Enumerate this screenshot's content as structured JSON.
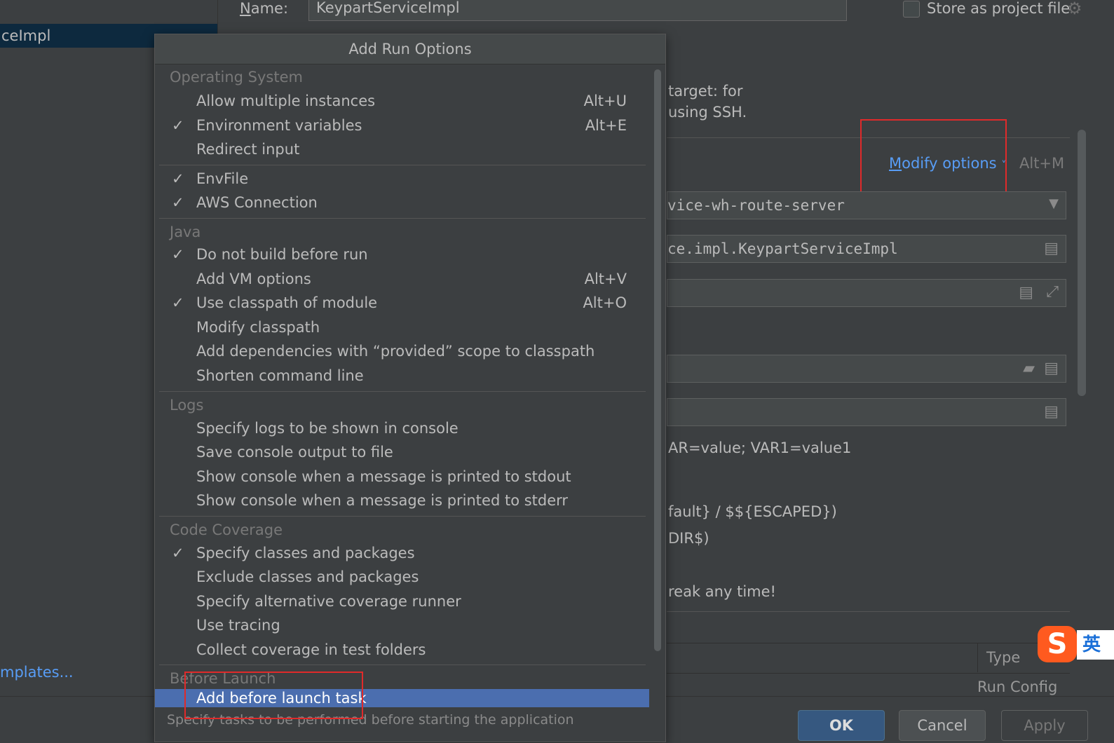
{
  "header": {
    "name_label": "Name:",
    "name_value": "KeypartServiceImpl",
    "store_label": "Store as project file"
  },
  "left_panel": {
    "selected_item": "ceImpl",
    "templates_link": "mplates..."
  },
  "right_panel": {
    "target_line1": "target: for",
    "target_line2": "using SSH.",
    "modify_options": "Modify options",
    "modify_shortcut": "Alt+M",
    "module_value": "vice-wh-route-server",
    "main_class_value": "ce.impl.KeypartServiceImpl",
    "env_hint": "AR=value; VAR1=value1",
    "escape_hint": "fault} / $${ESCAPED})",
    "dir_hint": "DIR$)",
    "break_hint": "reak any time!",
    "type_header": "Type",
    "run_config": "Run Config"
  },
  "buttons": {
    "ok": "OK",
    "cancel": "Cancel",
    "apply": "Apply"
  },
  "ime": {
    "char": "英"
  },
  "popup": {
    "title": "Add Run Options",
    "footer": "Specify tasks to be performed before starting the application",
    "sections": {
      "os": "Operating System",
      "java": "Java",
      "logs": "Logs",
      "coverage": "Code Coverage",
      "before_launch": "Before Launch"
    },
    "items": [
      {
        "label": "Allow multiple instances",
        "shortcut": "Alt+U",
        "checked": false
      },
      {
        "label": "Environment variables",
        "shortcut": "Alt+E",
        "checked": true
      },
      {
        "label": "Redirect input",
        "shortcut": "",
        "checked": false
      },
      {
        "label": "EnvFile",
        "shortcut": "",
        "checked": true
      },
      {
        "label": "AWS Connection",
        "shortcut": "",
        "checked": true
      },
      {
        "label": "Do not build before run",
        "shortcut": "",
        "checked": true
      },
      {
        "label": "Add VM options",
        "shortcut": "Alt+V",
        "checked": false
      },
      {
        "label": "Use classpath of module",
        "shortcut": "Alt+O",
        "checked": true
      },
      {
        "label": "Modify classpath",
        "shortcut": "",
        "checked": false
      },
      {
        "label": "Add dependencies with “provided” scope to classpath",
        "shortcut": "",
        "checked": false
      },
      {
        "label": "Shorten command line",
        "shortcut": "",
        "checked": false
      },
      {
        "label": "Specify logs to be shown in console",
        "shortcut": "",
        "checked": false
      },
      {
        "label": "Save console output to file",
        "shortcut": "",
        "checked": false
      },
      {
        "label": "Show console when a message is printed to stdout",
        "shortcut": "",
        "checked": false
      },
      {
        "label": "Show console when a message is printed to stderr",
        "shortcut": "",
        "checked": false
      },
      {
        "label": "Specify classes and packages",
        "shortcut": "",
        "checked": true
      },
      {
        "label": "Exclude classes and packages",
        "shortcut": "",
        "checked": false
      },
      {
        "label": "Specify alternative coverage runner",
        "shortcut": "",
        "checked": false
      },
      {
        "label": "Use tracing",
        "shortcut": "",
        "checked": false
      },
      {
        "label": "Collect coverage in test folders",
        "shortcut": "",
        "checked": false
      },
      {
        "label": "Add before launch task",
        "shortcut": "",
        "checked": false,
        "selected": true
      }
    ],
    "check_glyph": "✓"
  },
  "colors": {
    "background": "#3c3f41",
    "selection": "#4b6eaf",
    "link": "#589df6",
    "annotation_red": "#e02a2a",
    "ok_button": "#365880"
  }
}
